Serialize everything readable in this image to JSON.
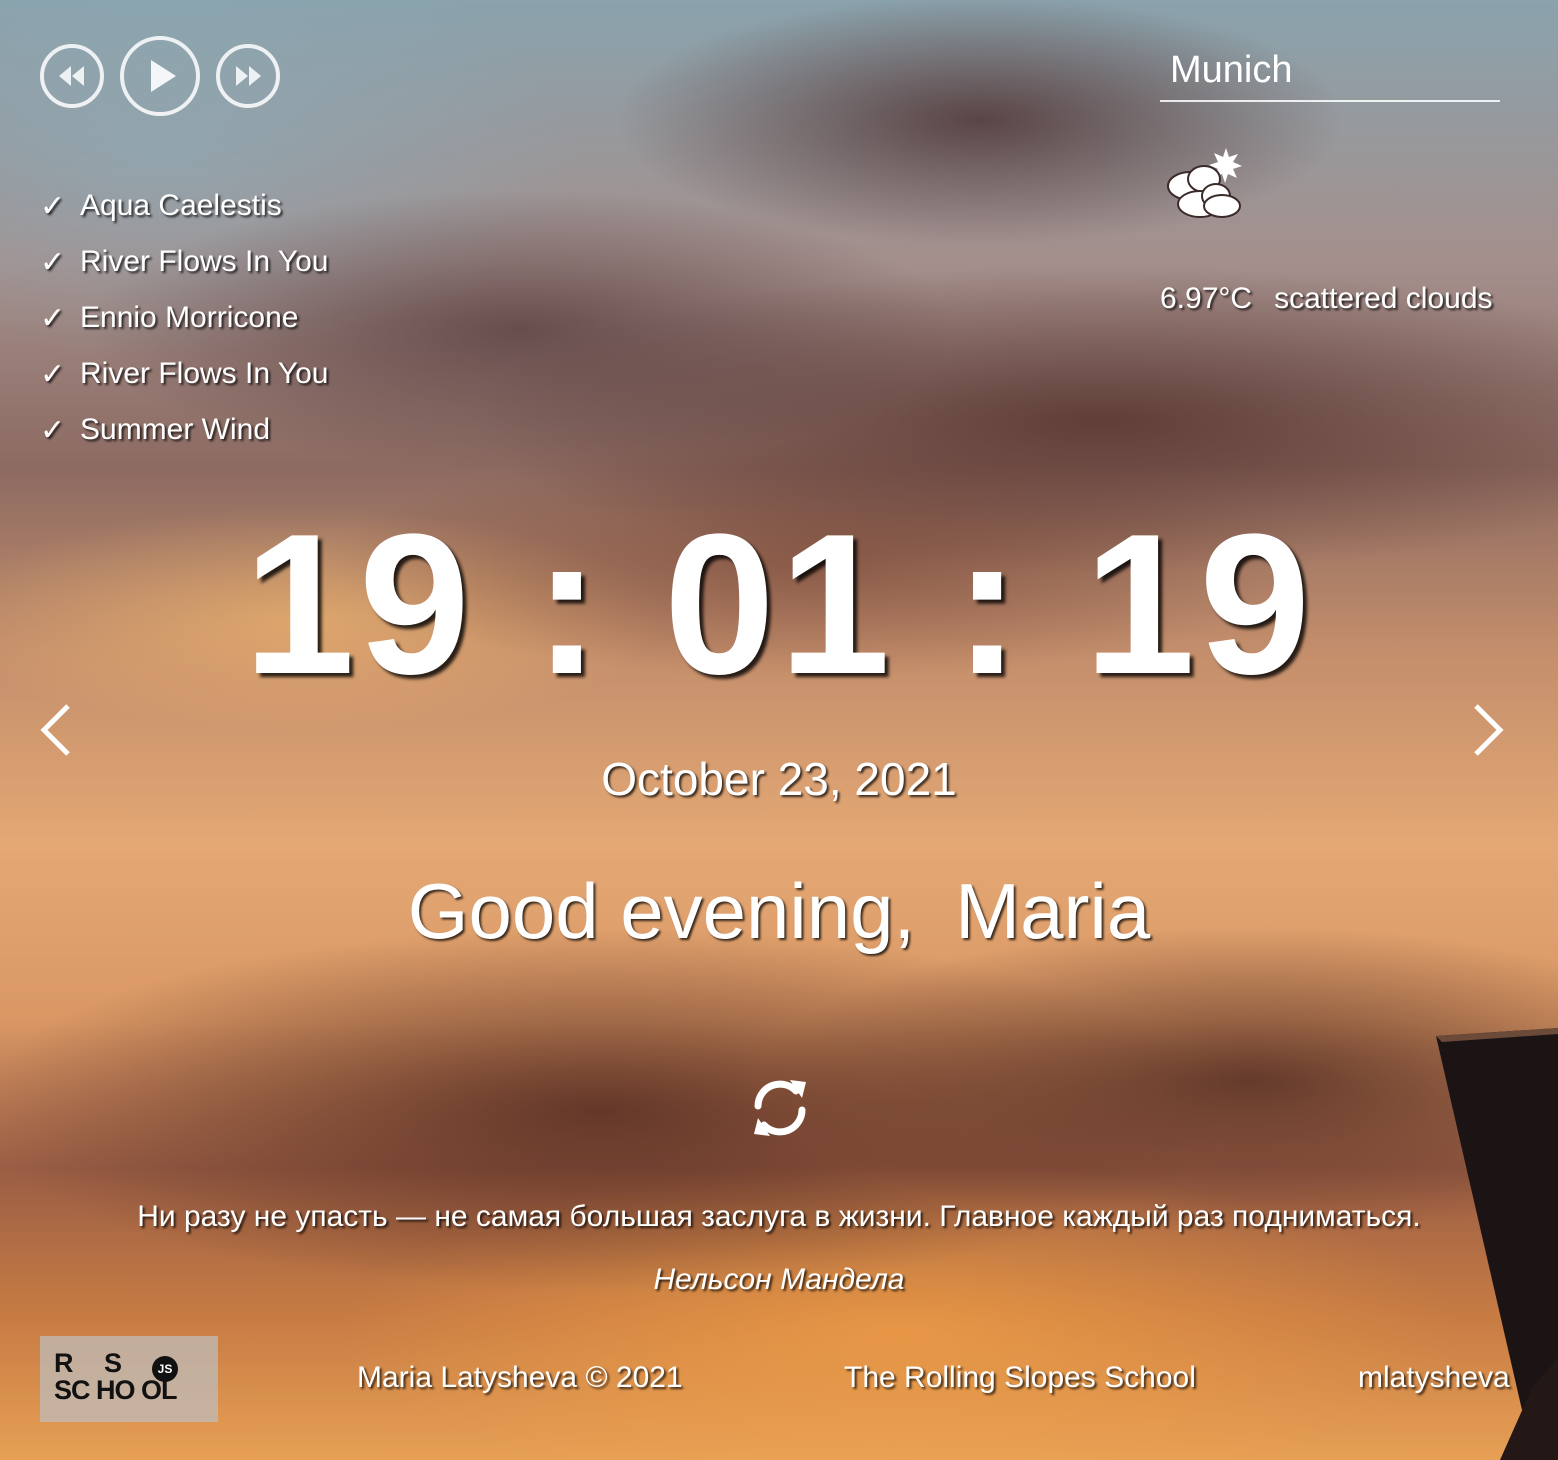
{
  "player": {
    "prev_icon": "rewind-icon",
    "play_icon": "play-icon",
    "next_icon": "fast-forward-icon",
    "check_mark": "✓",
    "playlist": [
      "Aqua Caelestis",
      "River Flows In You",
      "Ennio Morricone",
      "River Flows In You",
      "Summer Wind"
    ]
  },
  "weather": {
    "city": "Munich",
    "icon": "partly-cloudy-icon",
    "temperature": "6.97°C",
    "description": "scattered clouds"
  },
  "clock": {
    "time": "19 : 01 : 19",
    "date": "October 23, 2021"
  },
  "greeting": {
    "text": "Good evening,",
    "name": "Maria"
  },
  "slider": {
    "prev_icon": "chevron-left-icon",
    "next_icon": "chevron-right-icon"
  },
  "quote": {
    "refresh_icon": "refresh-icon",
    "text": "Ни разу не упасть — не самая большая заслуга в жизни. Главное каждый раз подниматься.",
    "author": "Нельсон Мандела"
  },
  "footer": {
    "logo": {
      "line1_left": "R",
      "line1_right": "S",
      "badge": "JS",
      "line2": "SC HO OL"
    },
    "copyright": "Maria Latysheva © 2021",
    "school": "The Rolling Slopes School",
    "github": "mlatysheva"
  },
  "colors": {
    "text": "#ffffff",
    "logo_bg": "#bebebe"
  }
}
